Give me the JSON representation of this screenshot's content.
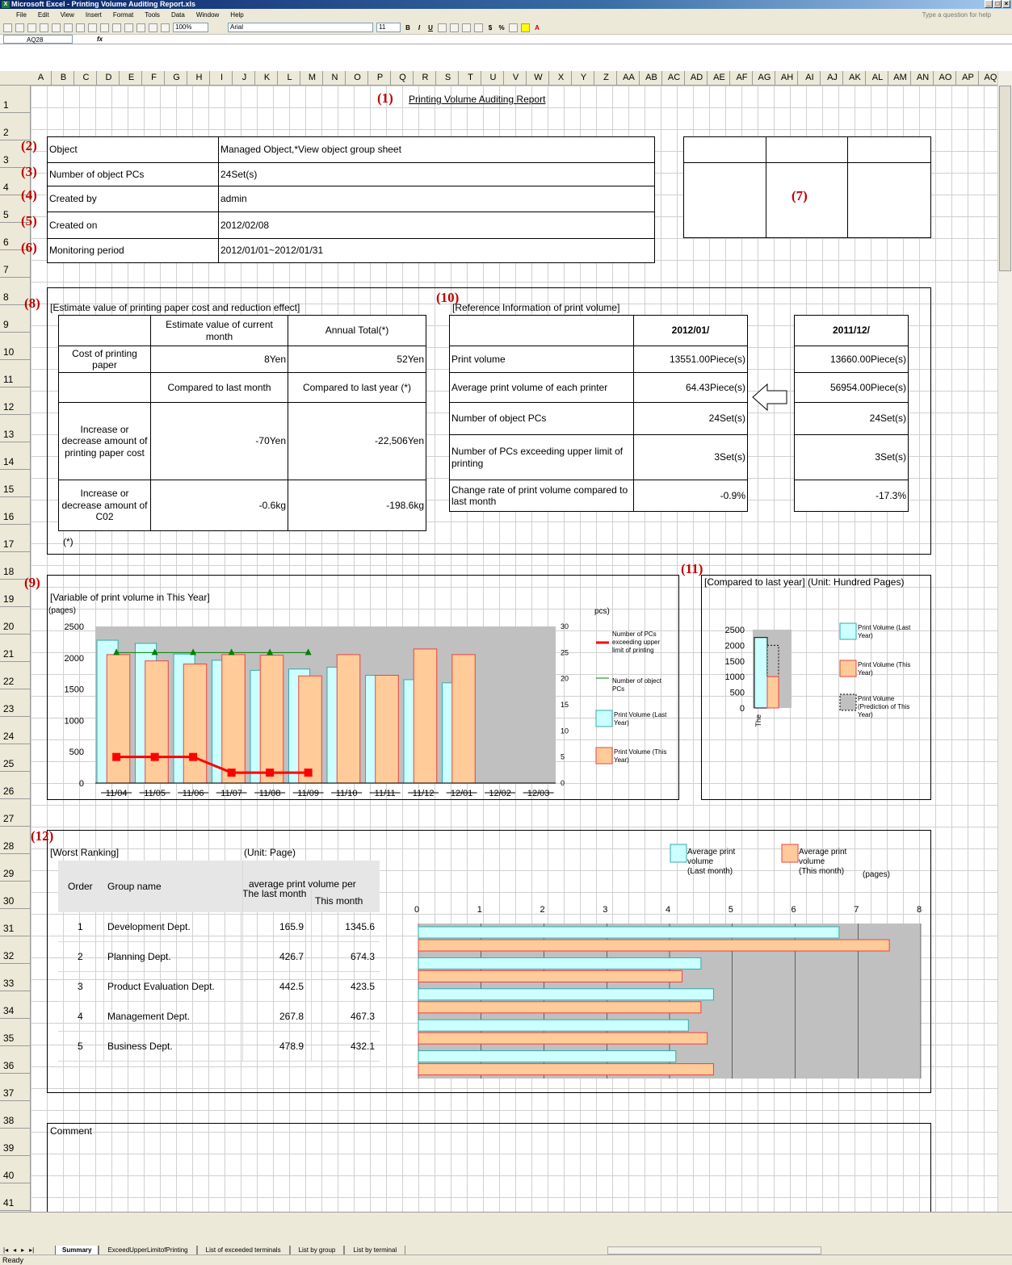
{
  "app": {
    "title": "Microsoft Excel - Printing Volume Auditing Report.xls",
    "icon": "excel-icon"
  },
  "menu": [
    "File",
    "Edit",
    "View",
    "Insert",
    "Format",
    "Tools",
    "Data",
    "Window",
    "Help"
  ],
  "help_placeholder": "Type a question for help",
  "toolbar": {
    "zoom": "100%",
    "font": "Arial",
    "size": "11"
  },
  "name_box": "AQ28",
  "fx": "fx",
  "columns": [
    "A",
    "B",
    "C",
    "D",
    "E",
    "F",
    "G",
    "H",
    "I",
    "J",
    "K",
    "L",
    "M",
    "N",
    "O",
    "P",
    "Q",
    "R",
    "S",
    "T",
    "U",
    "V",
    "W",
    "X",
    "Y",
    "Z",
    "AA",
    "AB",
    "AC",
    "AD",
    "AE",
    "AF",
    "AG",
    "AH",
    "AI",
    "AJ",
    "AK",
    "AL",
    "AM",
    "AN",
    "AO",
    "AP",
    "AQ"
  ],
  "rows": [
    "1",
    "2",
    "3",
    "4",
    "5",
    "6",
    "7",
    "8",
    "9",
    "10",
    "11",
    "12",
    "13",
    "14",
    "15",
    "16",
    "17",
    "18",
    "19",
    "20",
    "21",
    "22",
    "23",
    "24",
    "25",
    "26",
    "27",
    "28",
    "29",
    "30",
    "31",
    "32",
    "33",
    "34",
    "35",
    "36",
    "37",
    "38",
    "39",
    "40",
    "41"
  ],
  "report": {
    "title": "Printing Volume Auditing Report",
    "markers": [
      "(1)",
      "(2)",
      "(3)",
      "(4)",
      "(5)",
      "(6)",
      "(7)",
      "(8)",
      "(9)",
      "(10)",
      "(11)",
      "(12)"
    ],
    "info": [
      {
        "label": "Object",
        "value": "Managed Object,*View object group sheet"
      },
      {
        "label": "Number of object PCs",
        "value": "24Set(s)"
      },
      {
        "label": "Created by",
        "value": "admin"
      },
      {
        "label": "Created on",
        "value": "2012/02/08"
      },
      {
        "label": "Monitoring period",
        "value": "2012/01/01~2012/01/31"
      }
    ],
    "estimate": {
      "title": "[Estimate value of printing paper cost and reduction effect]",
      "h_current": "Estimate value of current month",
      "h_annual": "Annual Total(*)",
      "cost_label": "Cost of printing paper",
      "cost_current": "8Yen",
      "cost_annual": "52Yen",
      "h_month": "Compared to last month",
      "h_year": "Compared to last year (*)",
      "inc_paper_label": "Increase or decrease amount of printing paper cost",
      "inc_paper_month": "-70Yen",
      "inc_paper_year": "-22,506Yen",
      "inc_co2_label": "Increase or decrease amount of C02",
      "inc_co2_month": "-0.6kg",
      "inc_co2_year": "-198.6kg",
      "note": "(*)"
    },
    "reference": {
      "title": "[Reference Information of print volume]",
      "current_col": "2012/01/",
      "prev_col": "2011/12/",
      "rows": [
        {
          "label": "Print volume",
          "current": "13551.00Piece(s)",
          "prev": "13660.00Piece(s)"
        },
        {
          "label": "Average print volume of each printer",
          "current": "64.43Piece(s)",
          "prev": "56954.00Piece(s)"
        },
        {
          "label": "Number of object PCs",
          "current": "24Set(s)",
          "prev": "24Set(s)"
        },
        {
          "label": "Number of PCs exceeding upper limit of printing",
          "current": "3Set(s)",
          "prev": "3Set(s)"
        },
        {
          "label": "Change rate of print volume compared to last month",
          "current": "-0.9%",
          "prev": "-17.3%"
        }
      ]
    },
    "worst": {
      "title": "[Worst Ranking]",
      "unit": "(Unit: Page)",
      "h_order": "Order",
      "h_group": "Group name",
      "h_avg": "average print volume per",
      "h_last": "The last month",
      "h_this": "This month",
      "rows": [
        {
          "order": "1",
          "group": "Development Dept.",
          "last": "165.9",
          "this": "1345.6"
        },
        {
          "order": "2",
          "group": "Planning Dept.",
          "last": "426.7",
          "this": "674.3"
        },
        {
          "order": "3",
          "group": "Product Evaluation Dept.",
          "last": "442.5",
          "this": "423.5"
        },
        {
          "order": "4",
          "group": "Management Dept.",
          "last": "267.8",
          "this": "467.3"
        },
        {
          "order": "5",
          "group": "Business Dept.",
          "last": "478.9",
          "this": "432.1"
        }
      ]
    },
    "comment_label": "Comment"
  },
  "sheet_tabs": [
    "Summary",
    "ExceedUpperLimitofPrinting",
    "List of exceeded terminals",
    "List by group",
    "List by terminal"
  ],
  "status": "Ready",
  "chart_data": [
    {
      "type": "bar",
      "title": "[Variable of print volume in This Year]",
      "ylabel": "(pages)",
      "y2label": "pcs)",
      "categories": [
        "11/04",
        "11/05",
        "11/06",
        "11/07",
        "11/08",
        "11/09",
        "11/10",
        "11/11",
        "11/12",
        "12/01",
        "12/02",
        "12/03"
      ],
      "ylim": [
        0,
        2500
      ],
      "y2lim": [
        0,
        30
      ],
      "series": [
        {
          "name": "Print Volume (Last Year)",
          "color": "#ccffff",
          "values": [
            2280,
            2230,
            2060,
            1960,
            1800,
            1820,
            1850,
            1720,
            1650,
            1600,
            null,
            null
          ]
        },
        {
          "name": "Print Volume (This Year)",
          "color": "#ffcc99",
          "values": [
            2050,
            1950,
            1900,
            2050,
            2040,
            1710,
            2050,
            1720,
            2140,
            2050,
            null,
            null
          ]
        },
        {
          "name": "Number of PCs exceeding upper limit of printing",
          "color": "#ff0000",
          "axis": "right",
          "values": [
            5,
            5,
            5,
            2,
            2,
            2,
            null,
            null,
            null,
            null,
            null,
            null
          ]
        },
        {
          "name": "Number of object PCs",
          "color": "#008000",
          "axis": "right",
          "values": [
            25,
            25,
            25,
            25,
            25,
            25,
            null,
            null,
            null,
            null,
            null,
            null
          ]
        }
      ]
    },
    {
      "type": "bar",
      "title": "[Compared to last year] (Unit: Hundred Pages)",
      "ylim": [
        0,
        2500
      ],
      "categories": [
        "The"
      ],
      "series": [
        {
          "name": "Print Volume (Last Year)",
          "color": "#ccffff",
          "values": [
            2250
          ]
        },
        {
          "name": "Print Volume (This Year)",
          "color": "#ffcc99",
          "values": [
            1000
          ]
        },
        {
          "name": "Print Volume (Prediction of This Year)",
          "color": "#c0c0c0",
          "values": [
            2000
          ]
        }
      ]
    },
    {
      "type": "bar",
      "orientation": "horizontal",
      "xlim": [
        0,
        8
      ],
      "xlabel": "(pages)",
      "ticks": [
        "0",
        "1",
        "2",
        "3",
        "4",
        "5",
        "6",
        "7",
        "8"
      ],
      "series": [
        {
          "name": "Average print volume (Last month)",
          "color": "#ccffff",
          "values": [
            6.7,
            4.5,
            4.7,
            4.3,
            4.1
          ]
        },
        {
          "name": "Average print volume (This month)",
          "color": "#ffcc99",
          "values": [
            7.5,
            4.2,
            4.5,
            4.6,
            4.7
          ]
        }
      ]
    }
  ]
}
